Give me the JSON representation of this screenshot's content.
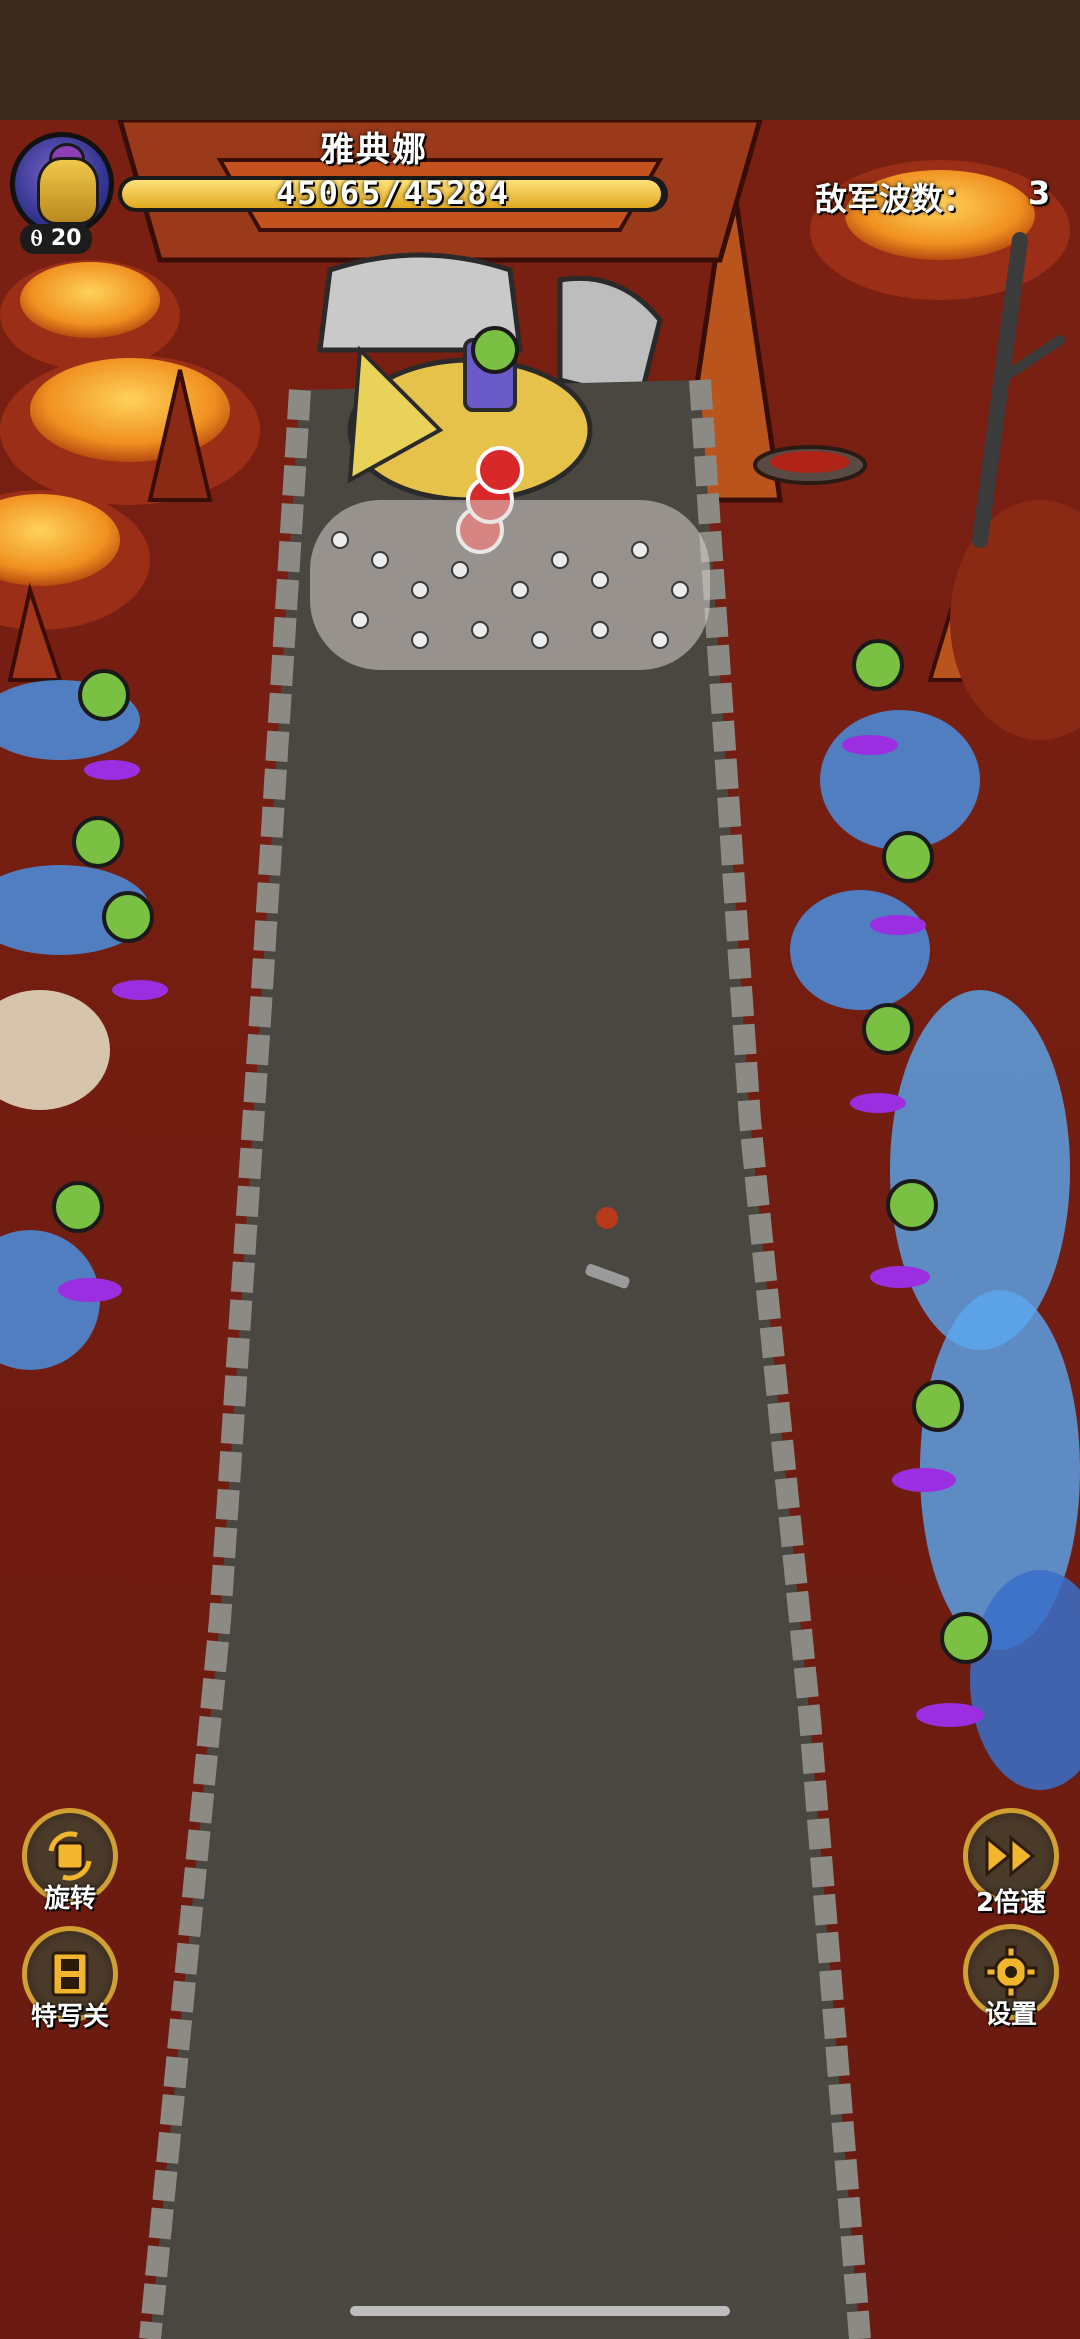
{
  "boss": {
    "name": "雅典娜",
    "hp_text": "45065/45284",
    "hp_fraction": 0.995,
    "level": "20",
    "level_icon": "gem-icon"
  },
  "wave": {
    "label": "敌军波数：",
    "value": "3"
  },
  "controls": {
    "rotate": {
      "label": "旋转",
      "icon": "rotate-icon"
    },
    "closeup": {
      "label": "特写关",
      "icon": "film-icon"
    },
    "speed": {
      "label": "2倍速",
      "icon": "fast-forward-icon"
    },
    "settings": {
      "label": "设置",
      "icon": "gear-icon"
    }
  },
  "colors": {
    "accent_gold": "#d1a033",
    "lava": "#f3a022",
    "ground": "#8a2418",
    "road": "#4a4640",
    "hero_badge": "#7ac043",
    "enemy_blue": "#4a8fe0"
  }
}
